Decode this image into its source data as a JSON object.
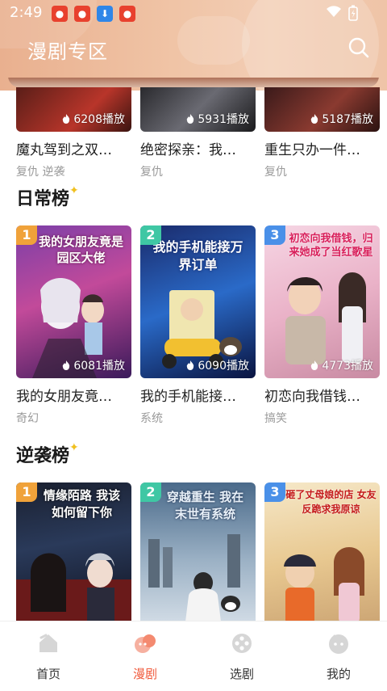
{
  "status_bar": {
    "time": "2:49"
  },
  "header": {
    "title": "漫剧专区"
  },
  "top_row": [
    {
      "plays": "6208播放",
      "title": "魔丸驾到之双…",
      "tags": "复仇 逆袭"
    },
    {
      "plays": "5931播放",
      "title": "绝密探亲：我…",
      "tags": "复仇"
    },
    {
      "plays": "5187播放",
      "title": "重生只办一件…",
      "tags": "复仇"
    }
  ],
  "sections": [
    {
      "title": "日常榜",
      "items": [
        {
          "rank": "1",
          "cover_text": "我的女朋友竟是园区大佬",
          "plays": "6081播放",
          "title": "我的女朋友竟…",
          "tags": "奇幻"
        },
        {
          "rank": "2",
          "cover_text": "我的手机能接万界订单",
          "plays": "6090播放",
          "title": "我的手机能接…",
          "tags": "系统"
        },
        {
          "rank": "3",
          "cover_text": "初恋向我借钱，归来她成了当红歌星",
          "plays": "4773播放",
          "title": "初恋向我借钱…",
          "tags": "搞笑"
        }
      ]
    },
    {
      "title": "逆袭榜",
      "items": [
        {
          "rank": "1",
          "cover_text": "情缘陌路 我该如何留下你"
        },
        {
          "rank": "2",
          "cover_text": "穿越重生 我在末世有系统"
        },
        {
          "rank": "3",
          "cover_text": "砸了丈母娘的店 女友反跪求我原谅"
        }
      ]
    }
  ],
  "bottom_nav": [
    {
      "label": "首页",
      "icon": "home-icon"
    },
    {
      "label": "漫剧",
      "icon": "drama-icon"
    },
    {
      "label": "选剧",
      "icon": "film-reel-icon"
    },
    {
      "label": "我的",
      "icon": "profile-icon"
    }
  ],
  "colors": {
    "accent": "#f05a3c",
    "rank1": "#f0a23a",
    "rank2": "#3fc7a4",
    "rank3": "#4a90e8"
  }
}
